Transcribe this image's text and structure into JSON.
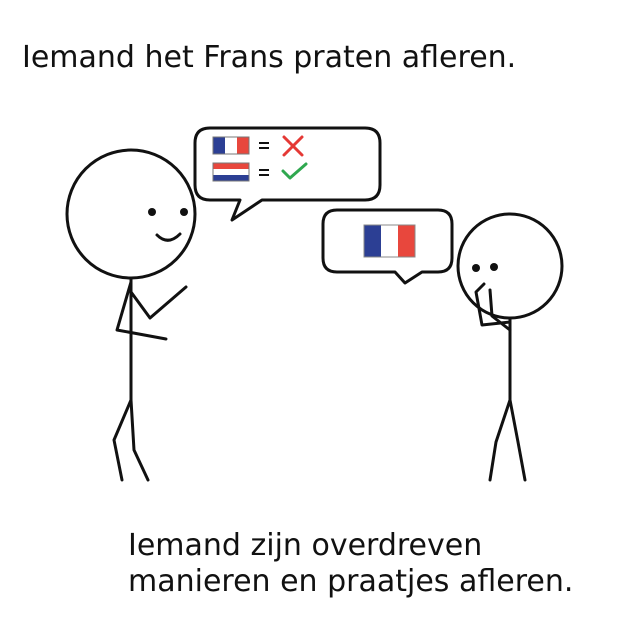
{
  "top_caption": "Iemand het Frans praten afleren.",
  "bottom_caption": {
    "line1": "Iemand zijn overdreven",
    "line2": "manieren en praatjes afleren."
  },
  "illustration": {
    "left_bubble": {
      "rows": [
        {
          "flag": "french-flag",
          "symbol": "=",
          "mark": "cross-icon"
        },
        {
          "flag": "dutch-flag",
          "symbol": "=",
          "mark": "check-icon"
        }
      ]
    },
    "right_bubble": {
      "flag": "french-flag"
    }
  },
  "colors": {
    "flag_blue": "#2c3f94",
    "flag_red": "#e8473d",
    "flag_white": "#ffffff",
    "cross": "#e53935",
    "check": "#2fa84f",
    "ink": "#111111"
  }
}
